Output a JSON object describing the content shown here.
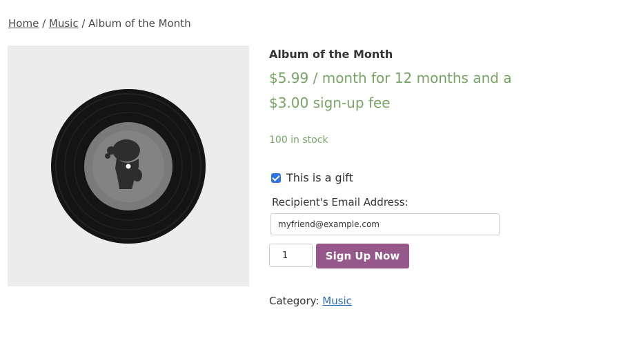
{
  "breadcrumb": {
    "home": "Home",
    "separator": " / ",
    "music": "Music",
    "current": "Album of the Month"
  },
  "product": {
    "image_icon": "vinyl-record-icon",
    "title": "Album of the Month",
    "price": "$5.99 / month for 12 months and a $3.00 sign-up fee",
    "stock": "100 in stock",
    "gift_checked": true,
    "gift_label": "This is a gift",
    "recipient_label": "Recipient's Email Address:",
    "recipient_email": "myfriend@example.com",
    "quantity": "1",
    "button_label": "Sign Up Now",
    "category_label": "Category: ",
    "category_link": "Music"
  },
  "colors": {
    "price": "#77a464",
    "button": "#96588a",
    "link": "#2a6ebb",
    "checkbox": "#2a72e5"
  }
}
